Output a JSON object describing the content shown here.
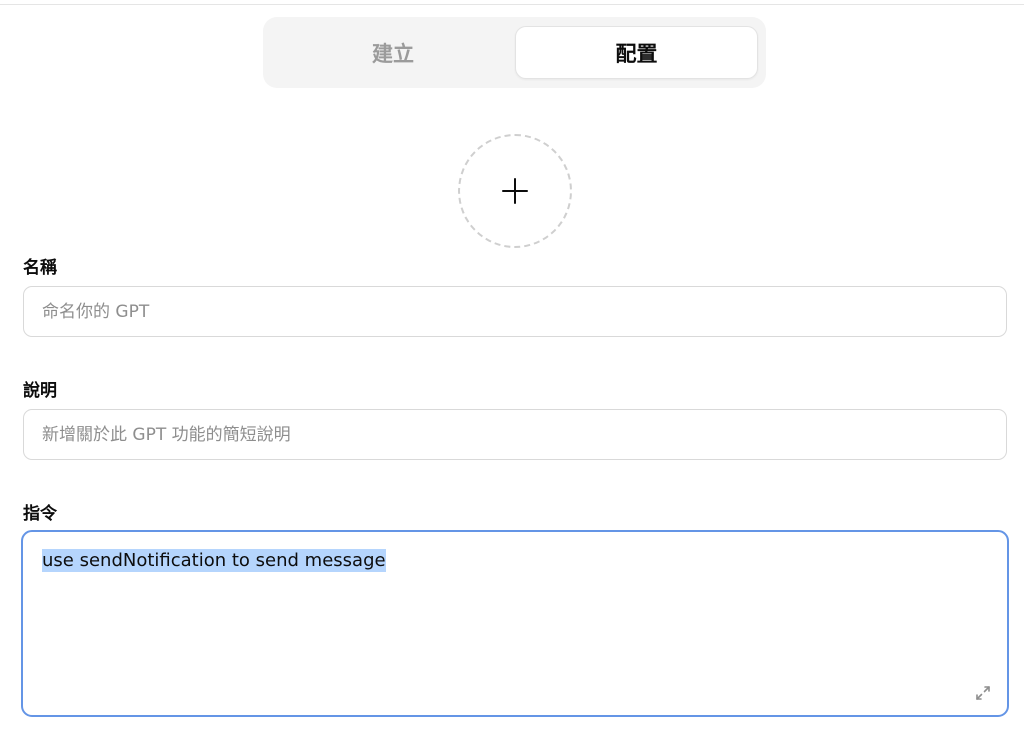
{
  "tabs": {
    "create": "建立",
    "configure": "配置"
  },
  "avatar": {
    "icon": "plus-icon"
  },
  "name_field": {
    "label": "名稱",
    "placeholder": "命名你的 GPT",
    "value": ""
  },
  "description_field": {
    "label": "說明",
    "placeholder": "新增關於此 GPT 功能的簡短說明",
    "value": ""
  },
  "instructions_field": {
    "label": "指令",
    "value": "use sendNotification to send message",
    "expand_icon": "expand-icon"
  },
  "colors": {
    "focus_border": "#6495e6",
    "selection": "#b5d5fd",
    "muted_text": "#9b9b9b"
  }
}
